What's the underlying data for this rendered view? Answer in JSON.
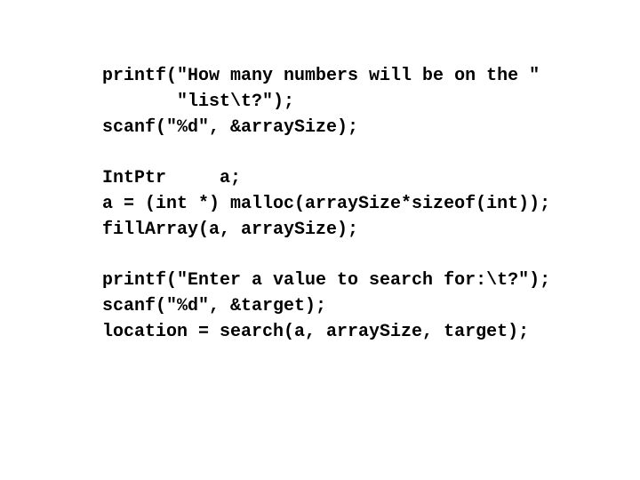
{
  "slide": {
    "code_groups": [
      {
        "lines": [
          "printf(\"How many numbers will be on the \"",
          "       \"list\\t?\");",
          "scanf(\"%d\", &arraySize);"
        ]
      },
      {
        "lines": [
          "IntPtr     a;",
          "a = (int *) malloc(arraySize*sizeof(int));",
          "fillArray(a, arraySize);"
        ]
      },
      {
        "lines": [
          "printf(\"Enter a value to search for:\\t?\");",
          "scanf(\"%d\", &target);",
          "location = search(a, arraySize, target);"
        ]
      }
    ]
  }
}
